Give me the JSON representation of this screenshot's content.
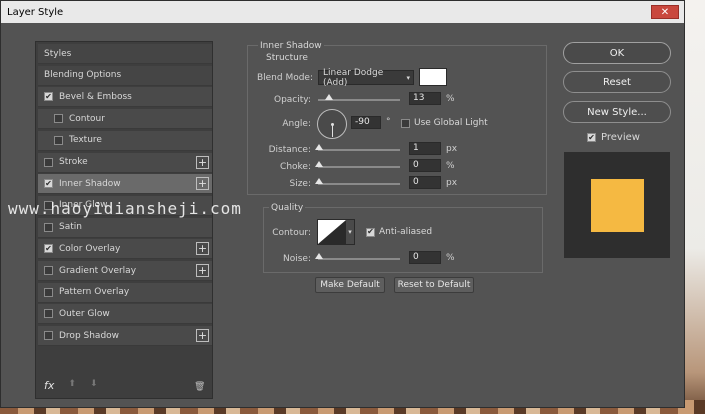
{
  "window": {
    "title": "Layer Style",
    "close_glyph": "✕"
  },
  "styles_panel": {
    "items": [
      {
        "label": "Styles",
        "checkbox": false,
        "checked": false,
        "plus": false,
        "indent": false,
        "active": false
      },
      {
        "label": "Blending Options",
        "checkbox": false,
        "checked": false,
        "plus": false,
        "indent": false,
        "active": false
      },
      {
        "label": "Bevel & Emboss",
        "checkbox": true,
        "checked": true,
        "plus": false,
        "indent": false,
        "active": false
      },
      {
        "label": "Contour",
        "checkbox": true,
        "checked": false,
        "plus": false,
        "indent": true,
        "active": false
      },
      {
        "label": "Texture",
        "checkbox": true,
        "checked": false,
        "plus": false,
        "indent": true,
        "active": false
      },
      {
        "label": "Stroke",
        "checkbox": true,
        "checked": false,
        "plus": true,
        "indent": false,
        "active": false
      },
      {
        "label": "Inner Shadow",
        "checkbox": true,
        "checked": true,
        "plus": true,
        "indent": false,
        "active": true
      },
      {
        "label": "Inner Glow",
        "checkbox": true,
        "checked": false,
        "plus": false,
        "indent": false,
        "active": false
      },
      {
        "label": "Satin",
        "checkbox": true,
        "checked": false,
        "plus": false,
        "indent": false,
        "active": false
      },
      {
        "label": "Color Overlay",
        "checkbox": true,
        "checked": true,
        "plus": true,
        "indent": false,
        "active": false
      },
      {
        "label": "Gradient Overlay",
        "checkbox": true,
        "checked": false,
        "plus": true,
        "indent": false,
        "active": false
      },
      {
        "label": "Pattern Overlay",
        "checkbox": true,
        "checked": false,
        "plus": false,
        "indent": false,
        "active": false
      },
      {
        "label": "Outer Glow",
        "checkbox": true,
        "checked": false,
        "plus": false,
        "indent": false,
        "active": false
      },
      {
        "label": "Drop Shadow",
        "checkbox": true,
        "checked": false,
        "plus": true,
        "indent": false,
        "active": false
      }
    ],
    "fx_label": "fx",
    "up_glyph": "⬆",
    "down_glyph": "⬇",
    "trash_glyph": "🗑"
  },
  "structure": {
    "section_title": "Inner Shadow",
    "group_title": "Structure",
    "blend_mode_label": "Blend Mode:",
    "blend_mode_value": "Linear Dodge (Add)",
    "blend_color": "#ffffff",
    "opacity_label": "Opacity:",
    "opacity_value": "13",
    "opacity_unit": "%",
    "opacity_fraction": 0.13,
    "angle_label": "Angle:",
    "angle_value": "-90",
    "angle_unit": "°",
    "global_light_label": "Use Global Light",
    "distance_label": "Distance:",
    "distance_value": "1",
    "distance_unit": "px",
    "choke_label": "Choke:",
    "choke_value": "0",
    "choke_unit": "%",
    "size_label": "Size:",
    "size_value": "0",
    "size_unit": "px"
  },
  "quality": {
    "group_title": "Quality",
    "contour_label": "Contour:",
    "anti_aliased_label": "Anti-aliased",
    "noise_label": "Noise:",
    "noise_value": "0",
    "noise_unit": "%"
  },
  "actions": {
    "make_default": "Make Default",
    "reset_default": "Reset to Default"
  },
  "right_buttons": {
    "ok": "OK",
    "reset": "Reset",
    "new_style": "New Style...",
    "preview_label": "Preview"
  },
  "preview": {
    "bg": "#2e2e2e",
    "swatch": "#f5b942"
  },
  "watermark": {
    "text": "www.haoyidiansheji.com"
  }
}
